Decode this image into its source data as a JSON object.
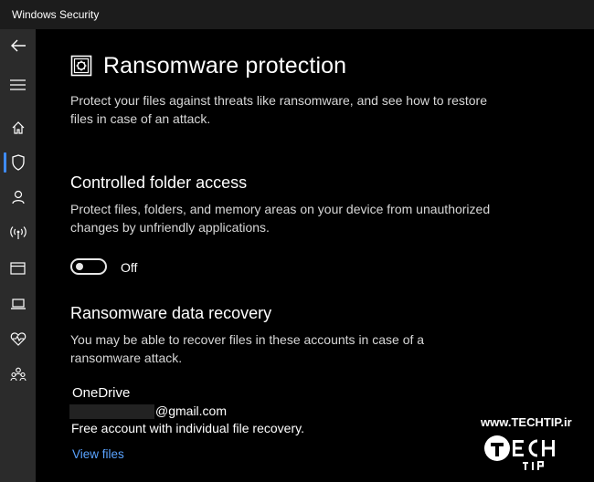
{
  "window": {
    "title": "Windows Security"
  },
  "sidebar": {
    "items": [
      {
        "icon": "back-arrow-icon"
      },
      {
        "icon": "hamburger-menu-icon"
      },
      {
        "icon": "home-icon"
      },
      {
        "icon": "shield-icon",
        "selected": true
      },
      {
        "icon": "person-icon"
      },
      {
        "icon": "wireless-icon"
      },
      {
        "icon": "app-browser-icon"
      },
      {
        "icon": "laptop-icon"
      },
      {
        "icon": "heart-pulse-icon"
      },
      {
        "icon": "family-icon"
      }
    ]
  },
  "page": {
    "title": "Ransomware protection",
    "description": "Protect your files against threats like ransomware, and see how to restore files in case of an attack."
  },
  "controlled_folder_access": {
    "title": "Controlled folder access",
    "description": "Protect files, folders, and memory areas on your device from unauthorized changes by unfriendly applications.",
    "toggle_state_label": "Off",
    "toggle_on": false
  },
  "data_recovery": {
    "title": "Ransomware data recovery",
    "description": "You may be able to recover files in these accounts in case of a ransomware attack.",
    "account_name": "OneDrive",
    "email_suffix": "@gmail.com",
    "account_note": "Free account with individual file recovery.",
    "view_files_label": "View files"
  },
  "watermark": {
    "url": "www.TECHTIP.ir",
    "logo_text": "TECH TIP"
  },
  "colors": {
    "accent": "#3f8cff",
    "link": "#5aa3ff",
    "sidebar_bg": "#2b2b2b",
    "titlebar_bg": "#1c1c1c",
    "content_bg": "#000000"
  }
}
